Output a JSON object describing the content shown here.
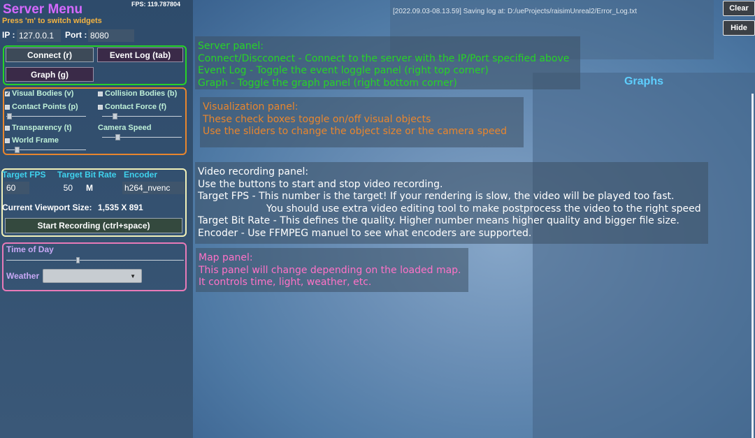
{
  "server_menu": {
    "title": "Server Menu",
    "fps": "FPS:  119.787804",
    "hint": "Press 'm' to switch widgets",
    "ip_label": "IP :",
    "ip_value": "127.0.0.1",
    "port_label": "Port :",
    "port_value": "8080",
    "buttons": {
      "connect": "Connect (r)",
      "event_log": "Event Log (tab)",
      "graph": "Graph (g)"
    },
    "visualization": {
      "visual_bodies": "Visual Bodies (v)",
      "visual_bodies_checked": true,
      "collision_bodies": "Collision Bodies (b)",
      "collision_bodies_checked": false,
      "contact_points": "Contact Points (p)",
      "contact_points_checked": false,
      "contact_force": "Contact Force (f)",
      "contact_force_checked": false,
      "transparency": "Transparency (t)",
      "transparency_checked": false,
      "camera_speed": "Camera Speed",
      "world_frame": "World Frame",
      "world_frame_checked": false
    },
    "video": {
      "target_fps_label": "Target FPS",
      "target_bitrate_label": "Target Bit Rate",
      "encoder_label": "Encoder",
      "target_fps_value": "60",
      "target_bitrate_value": "50",
      "bitrate_unit": "M",
      "encoder_value": "h264_nvenc",
      "viewport_size_label": "Current Viewport Size:",
      "viewport_size_value": "1,535  X  891",
      "record_button": "Start Recording (ctrl+space)"
    },
    "map": {
      "time_of_day": "Time of Day",
      "weather": "Weather"
    }
  },
  "log_message": "[2022.09.03-08.13.59] Saving log at: D:/ueProjects/raisimUnreal2/Error_Log.txt",
  "top_buttons": {
    "clear": "Clear",
    "hide": "Hide"
  },
  "graphs_title": "Graphs",
  "help": {
    "server": [
      "Server panel:",
      "Connect/Discconect - Connect to the server with the IP/Port specified above",
      "Event Log - Toggle the event loggle panel (right top corner)",
      "Graph - Toggle the graph panel (right bottom corner)"
    ],
    "visualization": [
      "Visualization panel:",
      "These check boxes toggle on/off visual objects",
      "Use the sliders to change the object size or the camera speed"
    ],
    "video": [
      "Video recording panel:",
      "Use the buttons to start and stop video recording.",
      "Target FPS - This number is the target! If your rendering is slow, the video will be played too fast.",
      "                      You should use extra video editing tool to make postprocess the video to the right speed",
      "Target Bit Rate - This defines the quality. Higher number means higher quality and bigger file size.",
      "Encoder - Use FFMPEG manuel to see what encoders are supported."
    ],
    "map": [
      "Map panel:",
      "This panel will change depending on the loaded map.",
      "It controls time, light, weather, etc."
    ]
  },
  "colors": {
    "server_box": "#27d327",
    "visualization_box": "#e9862d",
    "video_box": "#f1f1b9",
    "map_box": "#e87ab8",
    "help_server_text": "#27d327",
    "help_visual_text": "#e9862d",
    "help_video_text": "#ffffff",
    "help_map_text": "#ff72c7"
  }
}
